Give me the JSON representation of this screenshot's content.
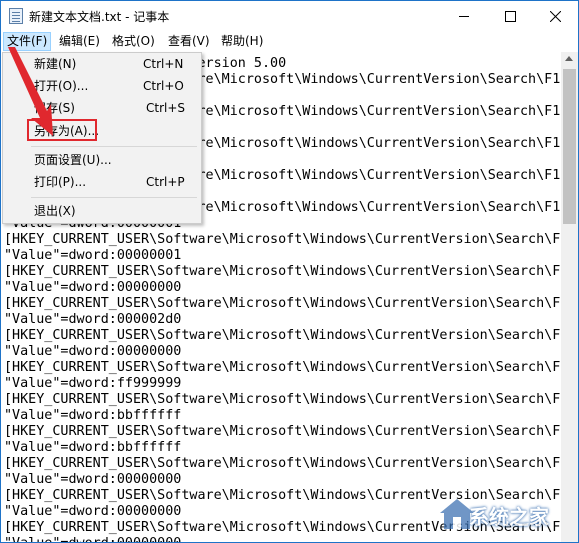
{
  "window": {
    "title": "新建文本文档.txt - 记事本"
  },
  "menubar": {
    "items": [
      {
        "label": "文件(F)"
      },
      {
        "label": "编辑(E)"
      },
      {
        "label": "格式(O)"
      },
      {
        "label": "查看(V)"
      },
      {
        "label": "帮助(H)"
      }
    ]
  },
  "file_menu": {
    "items": [
      {
        "label": "新建(N)",
        "shortcut": "Ctrl+N"
      },
      {
        "label": "打开(O)...",
        "shortcut": "Ctrl+O"
      },
      {
        "label": "保存(S)",
        "shortcut": "Ctrl+S"
      },
      {
        "label": "另存为(A)...",
        "shortcut": ""
      },
      {
        "label": "页面设置(U)...",
        "shortcut": ""
      },
      {
        "label": "打印(P)...",
        "shortcut": "Ctrl+P"
      },
      {
        "label": "退出(X)",
        "shortcut": ""
      }
    ],
    "highlighted": "另存为(A)...",
    "highlight_color": "#e0282e"
  },
  "editor": {
    "visible_lines": [
      "                        ersion 5.00",
      "                        re\\Microsoft\\Windows\\CurrentVersion\\Search\\F1",
      "",
      "                        re\\Microsoft\\Windows\\CurrentVersion\\Search\\F1",
      "",
      "                        re\\Microsoft\\Windows\\CurrentVersion\\Search\\F1",
      "",
      "                        re\\Microsoft\\Windows\\CurrentVersion\\Search\\F1",
      "",
      "                        re\\Microsoft\\Windows\\CurrentVersion\\Search\\F1",
      "\"Value\"=dword:00000001",
      "[HKEY_CURRENT_USER\\Software\\Microsoft\\Windows\\CurrentVersion\\Search\\F1",
      "\"Value\"=dword:00000001",
      "[HKEY_CURRENT_USER\\Software\\Microsoft\\Windows\\CurrentVersion\\Search\\F1",
      "\"Value\"=dword:00000000",
      "[HKEY_CURRENT_USER\\Software\\Microsoft\\Windows\\CurrentVersion\\Search\\F1",
      "\"Value\"=dword:000002d0",
      "[HKEY_CURRENT_USER\\Software\\Microsoft\\Windows\\CurrentVersion\\Search\\F1",
      "\"Value\"=dword:00000000",
      "[HKEY_CURRENT_USER\\Software\\Microsoft\\Windows\\CurrentVersion\\Search\\F1",
      "\"Value\"=dword:ff999999",
      "[HKEY_CURRENT_USER\\Software\\Microsoft\\Windows\\CurrentVersion\\Search\\F1",
      "\"Value\"=dword:bbffffff",
      "[HKEY_CURRENT_USER\\Software\\Microsoft\\Windows\\CurrentVersion\\Search\\F1",
      "\"Value\"=dword:bbffffff",
      "[HKEY_CURRENT_USER\\Software\\Microsoft\\Windows\\CurrentVersion\\Search\\F1",
      "\"Value\"=dword:00000000",
      "[HKEY_CURRENT_USER\\Software\\Microsoft\\Windows\\CurrentVersion\\Search\\F1",
      "\"Value\"=dword:00000000",
      "[HKEY_CURRENT_USER\\Software\\Microsoft\\Windows\\CurrentVersion\\Search\\F1",
      "\"Value\"=dword:00000000"
    ]
  },
  "watermark": {
    "text": "系统之家"
  },
  "colors": {
    "window_border": "#1e73c8",
    "menu_active_bg": "#cce8ff",
    "annotation_red": "#e0282e"
  }
}
